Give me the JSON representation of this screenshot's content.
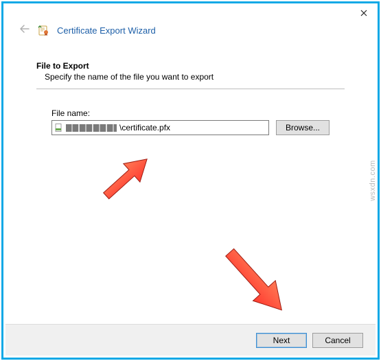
{
  "header": {
    "wizard_title": "Certificate Export Wizard"
  },
  "section": {
    "title": "File to Export",
    "subtitle": "Specify the name of the file you want to export"
  },
  "file": {
    "label": "File name:",
    "value_visible_suffix": "\\certificate.pfx",
    "browse_label": "Browse..."
  },
  "footer": {
    "next_label": "Next",
    "cancel_label": "Cancel"
  },
  "watermark": "wsxdn.com"
}
